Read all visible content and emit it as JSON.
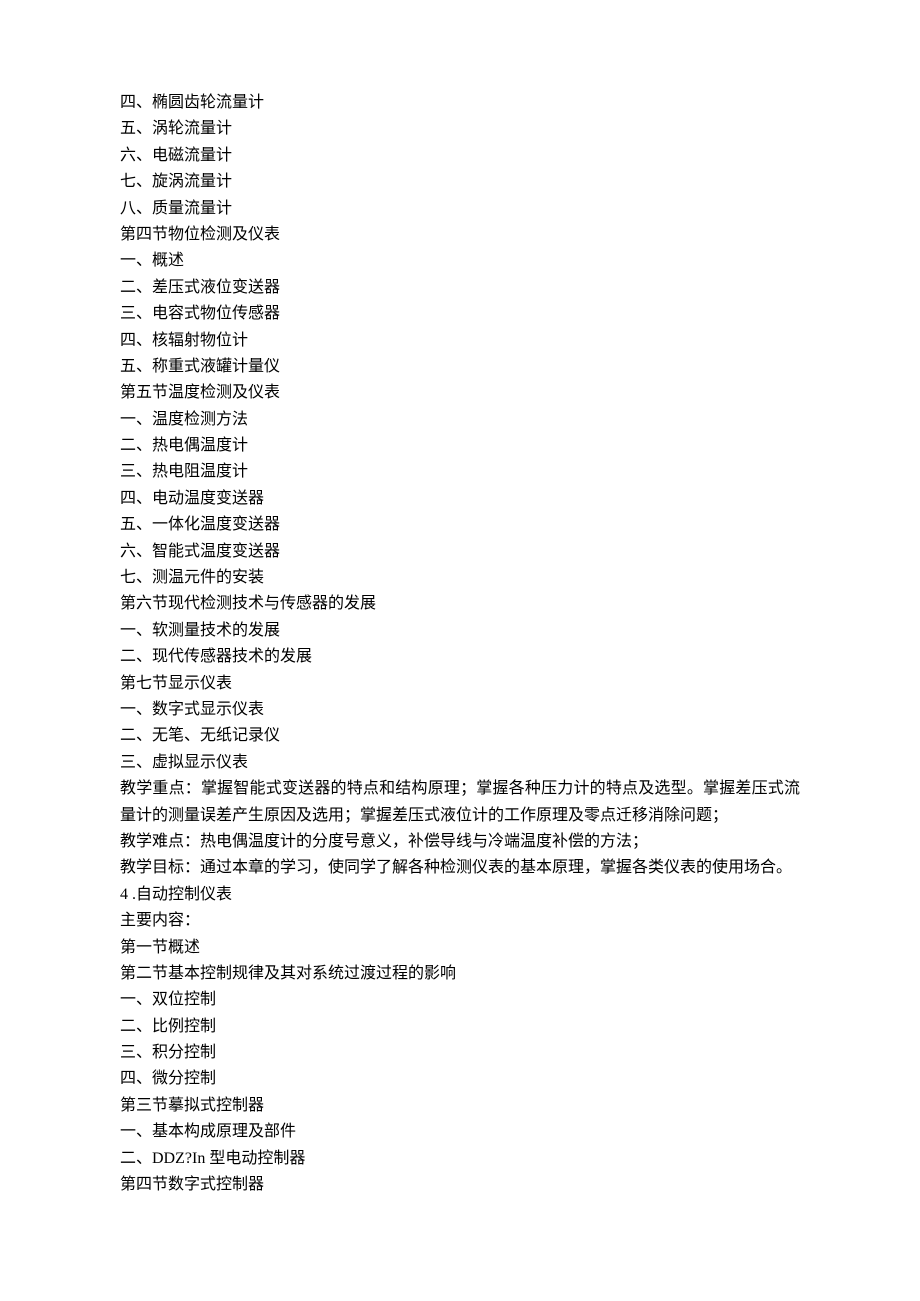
{
  "lines": [
    "四、椭圆齿轮流量计",
    "五、涡轮流量计",
    "六、电磁流量计",
    "七、旋涡流量计",
    "八、质量流量计",
    "第四节物位检测及仪表",
    "一、概述",
    "二、差压式液位变送器",
    "三、电容式物位传感器",
    "四、核辐射物位计",
    "五、称重式液罐计量仪",
    "第五节温度检测及仪表",
    "一、温度检测方法",
    "二、热电偶温度计",
    "三、热电阻温度计",
    "四、电动温度变送器",
    "五、一体化温度变送器",
    "六、智能式温度变送器",
    "七、测温元件的安装",
    "第六节现代检测技术与传感器的发展",
    "一、软测量技术的发展",
    "二、现代传感器技术的发展",
    "第七节显示仪表",
    "一、数字式显示仪表",
    "二、无笔、无纸记录仪",
    "三、虚拟显示仪表",
    "教学重点：掌握智能式变送器的特点和结构原理；掌握各种压力计的特点及选型。掌握差压式流量计的测量误差产生原因及选用；掌握差压式液位计的工作原理及零点迁移消除问题；",
    "教学难点：热电偶温度计的分度号意义，补偿导线与冷端温度补偿的方法；",
    "教学目标：通过本章的学习，使同学了解各种检测仪表的基本原理，掌握各类仪表的使用场合。",
    "4 .自动控制仪表",
    "主要内容：",
    "第一节概述",
    "第二节基本控制规律及其对系统过渡过程的影响",
    "一、双位控制",
    "二、比例控制",
    "三、积分控制",
    "四、微分控制",
    "第三节摹拟式控制器",
    "一、基本构成原理及部件",
    "二、DDZ?In 型电动控制器",
    "第四节数字式控制器"
  ]
}
